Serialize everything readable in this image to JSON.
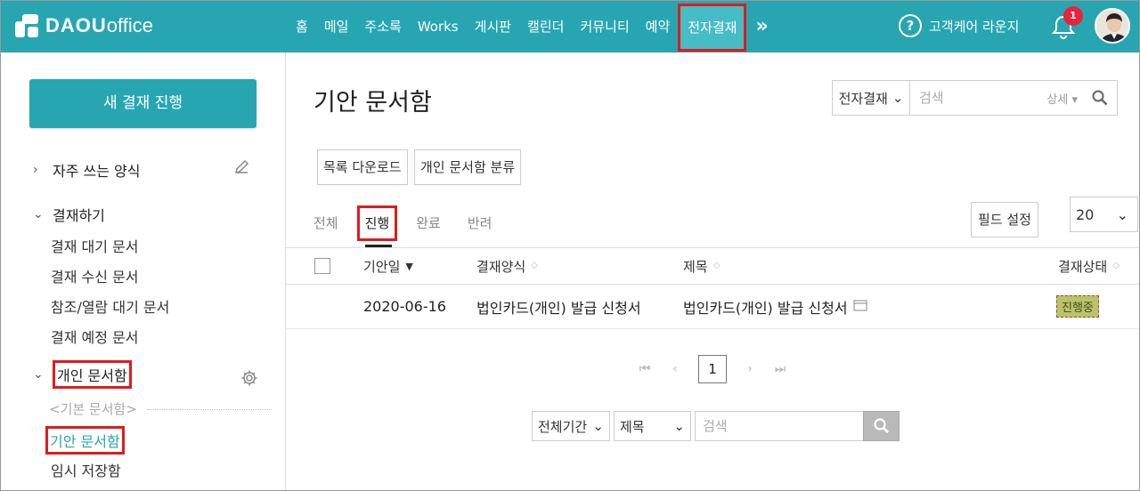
{
  "header": {
    "logo_main": "DAOU",
    "logo_sub": "office",
    "nav": [
      "홈",
      "메일",
      "주소록",
      "Works",
      "게시판",
      "캘린더",
      "커뮤니티",
      "예약",
      "전자결재"
    ],
    "active_nav": "전자결재",
    "help_label": "고객케어 라운지",
    "notification_count": "1",
    "accent_color": "#27a6b2"
  },
  "sidebar": {
    "new_button": "새 결재 진행",
    "favorites": "자주 쓰는 양식",
    "approval_section": "결재하기",
    "approval_links": [
      "결재 대기 문서",
      "결재 수신 문서",
      "참조/열람 대기 문서",
      "결재 예정 문서"
    ],
    "personal_section": "개인 문서함",
    "basic_folder": "<기본 문서함>",
    "draft_box": "기안 문서함",
    "temp_save": "임시 저장함"
  },
  "main": {
    "title": "기안 문서함",
    "search_scope": "전자결재",
    "search_placeholder": "검색",
    "detail_label": "상세",
    "download_btn": "목록 다운로드",
    "classify_btn": "개인 문서함 분류",
    "tabs": [
      "전체",
      "진행",
      "완료",
      "반려"
    ],
    "active_tab": "진행",
    "field_settings": "필드 설정",
    "page_size": "20",
    "columns": {
      "date": "기안일",
      "form": "결재양식",
      "subject": "제목",
      "status": "결재상태"
    },
    "rows": [
      {
        "date": "2020-06-16",
        "form": "법인카드(개인) 발급 신청서",
        "subject": "법인카드(개인) 발급 신청서",
        "status": "진행중"
      }
    ],
    "pager": {
      "current": "1"
    },
    "bottom_search": {
      "period": "전체기간",
      "field": "제목",
      "placeholder": "검색"
    }
  }
}
